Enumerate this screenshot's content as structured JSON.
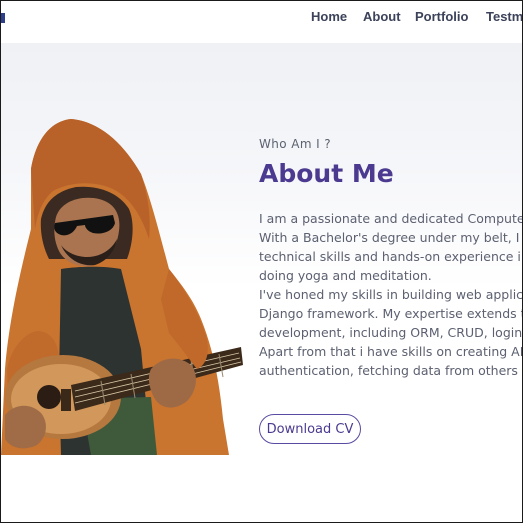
{
  "nav": {
    "items": [
      {
        "label": "Home"
      },
      {
        "label": "About"
      },
      {
        "label": "Portfolio"
      },
      {
        "label": "Testm"
      }
    ]
  },
  "about": {
    "eyebrow": "Who Am I ?",
    "heading": "About Me",
    "bio_lines": [
      "I am a passionate and dedicated Computer",
      "With a Bachelor's degree under my belt, I ha",
      "technical skills and hands-on experience in",
      "doing yoga and meditation.",
      "I've honed my skills in building web applicat",
      "Django framework. My expertise extends to",
      "development, including ORM, CRUD, login/lo",
      "Apart from that i have skills on creating API",
      "authentication, fetching data from others A"
    ],
    "cv_button": "Download CV"
  },
  "colors": {
    "accent": "#4b3a8f",
    "nav_text": "#3b4259",
    "body_text": "#5c6070"
  }
}
